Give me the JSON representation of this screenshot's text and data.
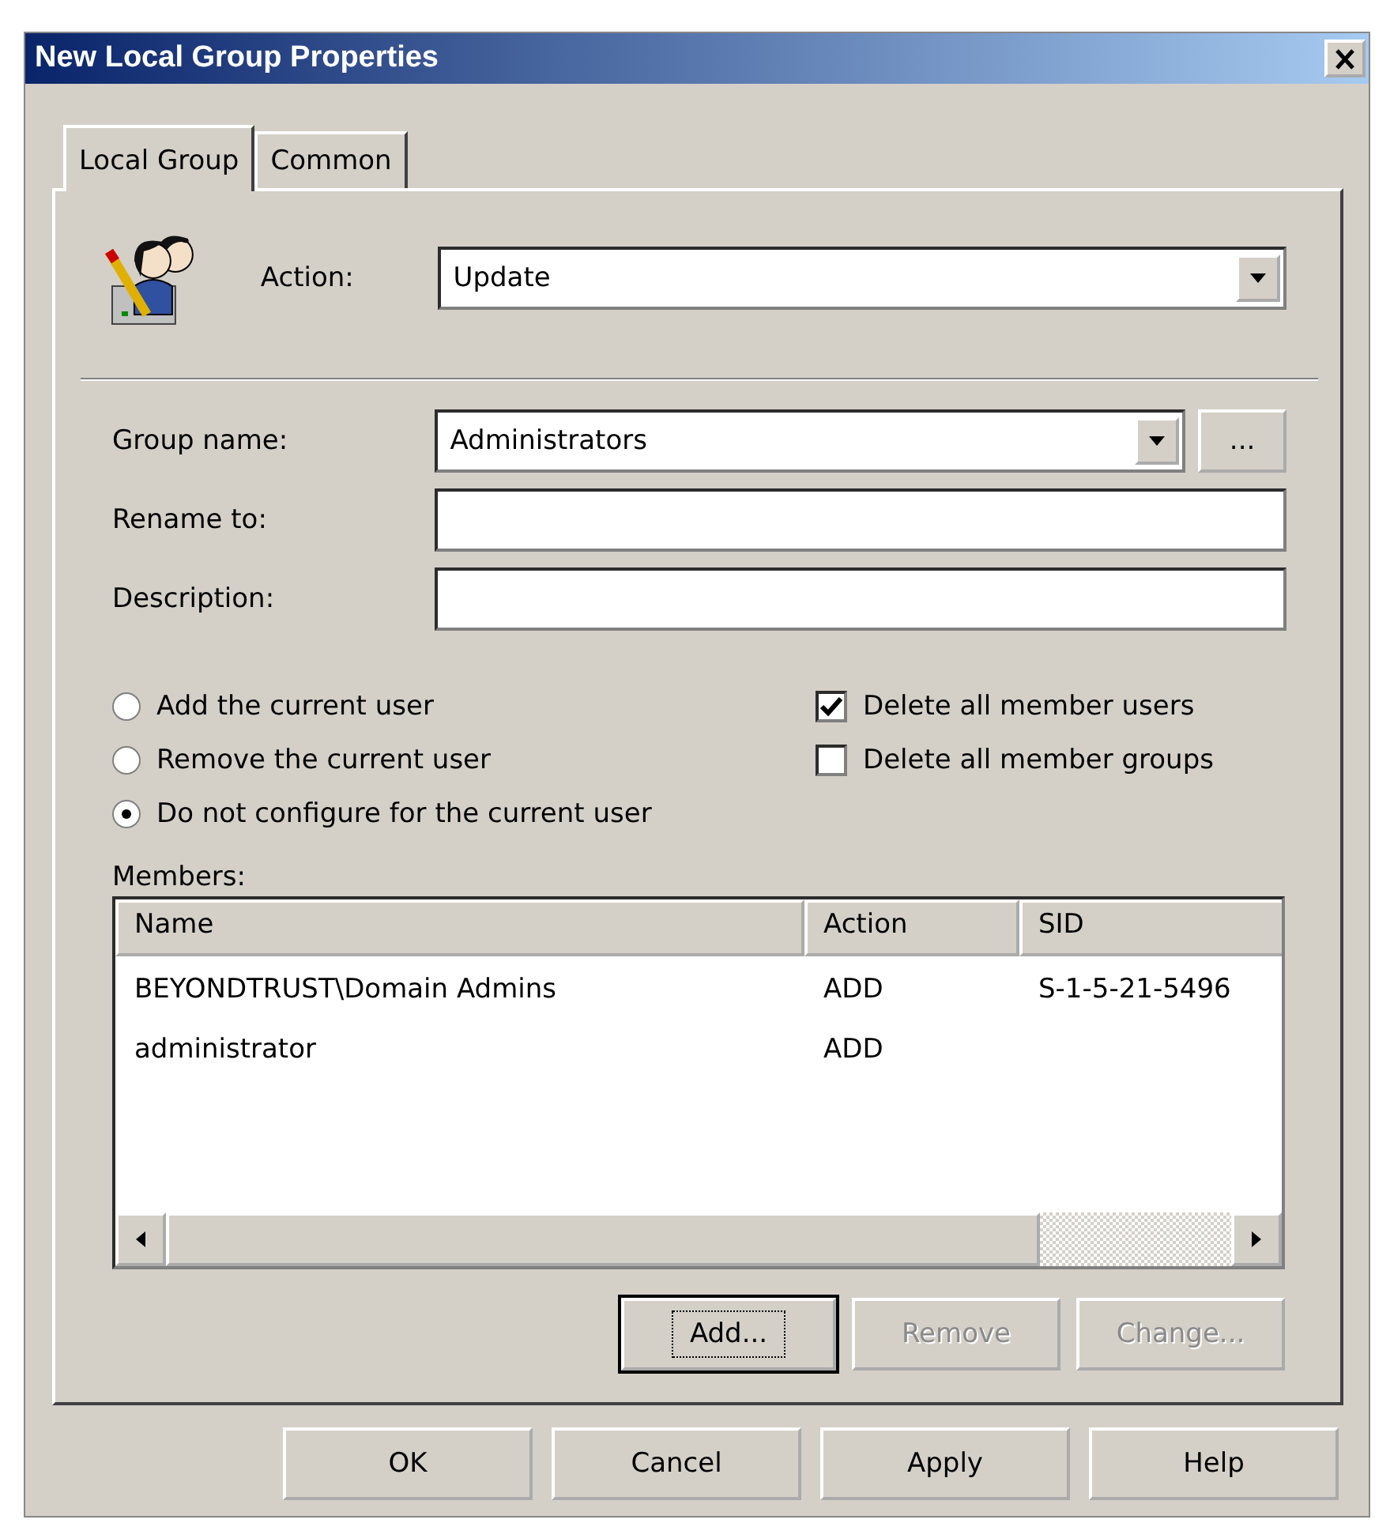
{
  "window": {
    "title": "New Local Group Properties"
  },
  "tabs": [
    {
      "label": "Local Group",
      "selected": true
    },
    {
      "label": "Common",
      "selected": false
    }
  ],
  "action": {
    "label": "Action:",
    "value": "Update"
  },
  "fields": [
    {
      "label": "Group name:",
      "value": "Administrators",
      "kind": "combo",
      "browse": "..."
    },
    {
      "label": "Rename to:",
      "kind": "text"
    },
    {
      "label": "Description:",
      "kind": "text"
    }
  ],
  "radios": [
    {
      "label": "Add the current user",
      "selected": false
    },
    {
      "label": "Remove the current user",
      "selected": false
    },
    {
      "label": "Do not configure for the current user",
      "selected": true
    }
  ],
  "checkboxes": [
    {
      "label": "Delete all member users",
      "checked": true
    },
    {
      "label": "Delete all member groups",
      "checked": false
    }
  ],
  "members": {
    "label": "Members:",
    "columns": [
      "Name",
      "Action",
      "SID"
    ],
    "rows": [
      {
        "name": "BEYONDTRUST\\Domain Admins",
        "action": "ADD",
        "sid": "S-1-5-21-5496"
      },
      {
        "name": "administrator",
        "action": "ADD"
      }
    ]
  },
  "member_buttons": [
    {
      "label": "Add...",
      "disabled": false,
      "focused": true
    },
    {
      "label": "Remove",
      "disabled": true,
      "focused": false
    },
    {
      "label": "Change...",
      "disabled": true,
      "focused": false
    }
  ],
  "dialog_buttons": [
    "OK",
    "Cancel",
    "Apply",
    "Help"
  ]
}
